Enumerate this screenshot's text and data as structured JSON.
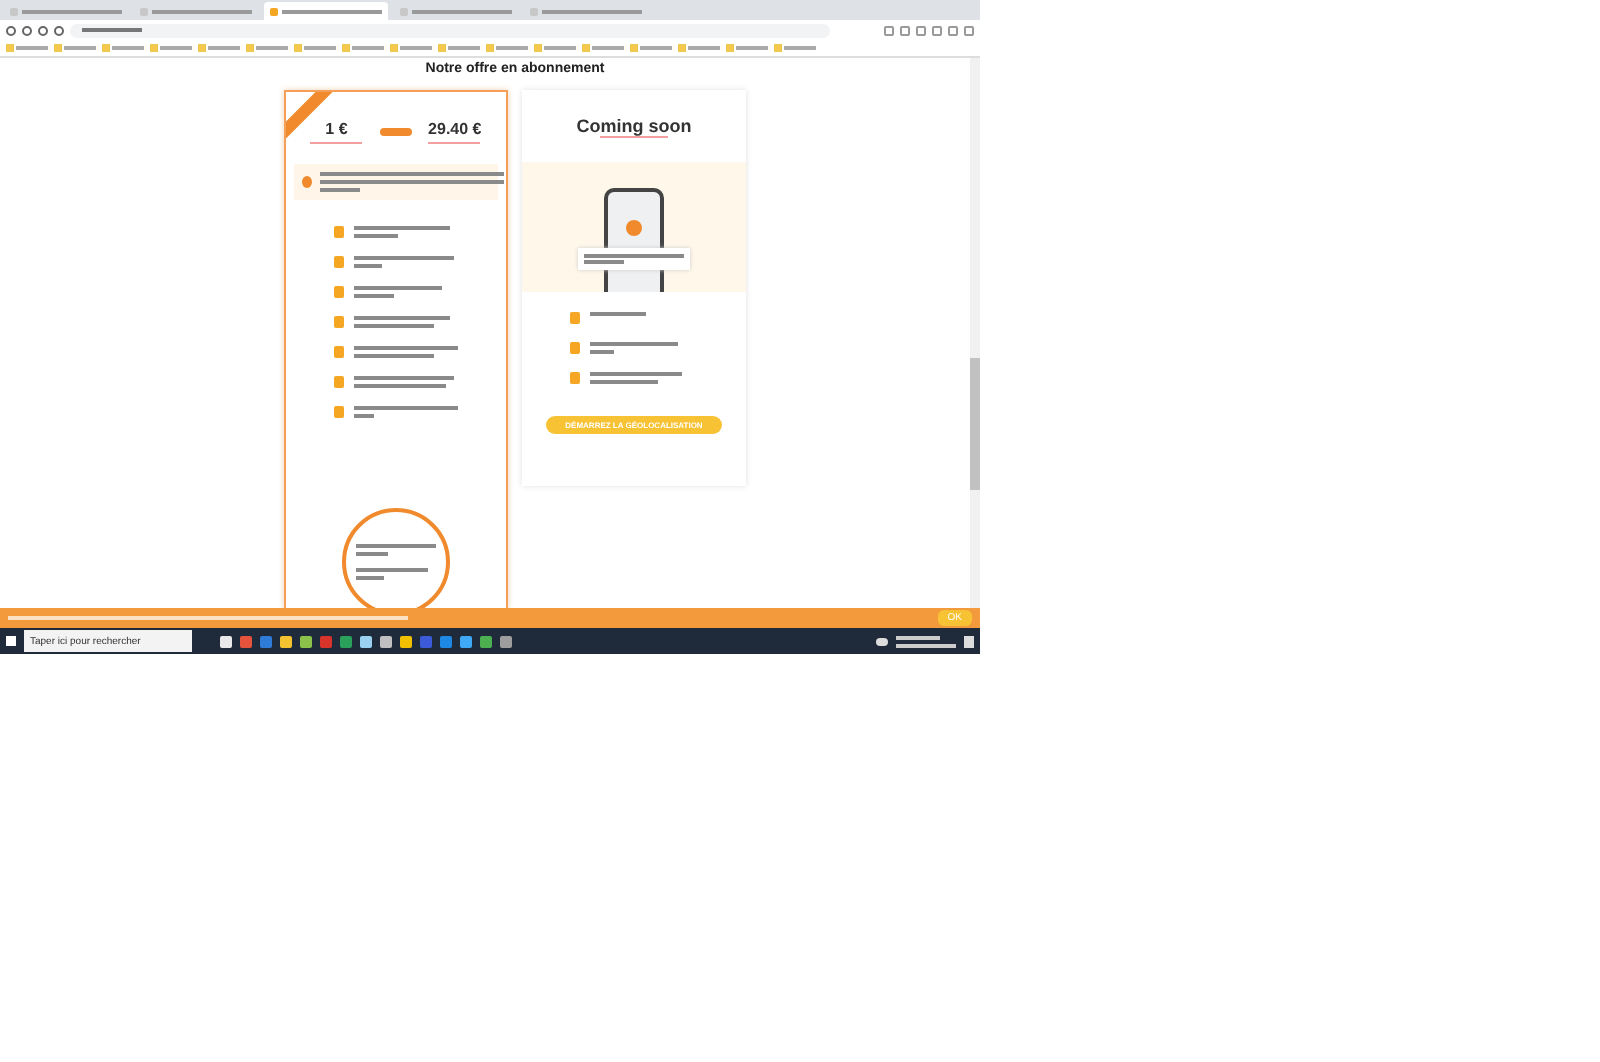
{
  "browser": {
    "tabs": [
      {
        "selected": false
      },
      {
        "selected": false
      },
      {
        "selected": true
      },
      {
        "selected": false
      },
      {
        "selected": false
      }
    ]
  },
  "page": {
    "heading": "Notre offre en abonnement",
    "offer_card": {
      "price_from": "1 €",
      "price_to": "29.40 €"
    },
    "coming_card": {
      "title": "Coming soon",
      "button": "DÉMARREZ LA GÉOLOCALISATION"
    }
  },
  "cookie_banner": {
    "button": "OK"
  },
  "taskbar": {
    "search_placeholder": "Taper ici pour rechercher"
  }
}
